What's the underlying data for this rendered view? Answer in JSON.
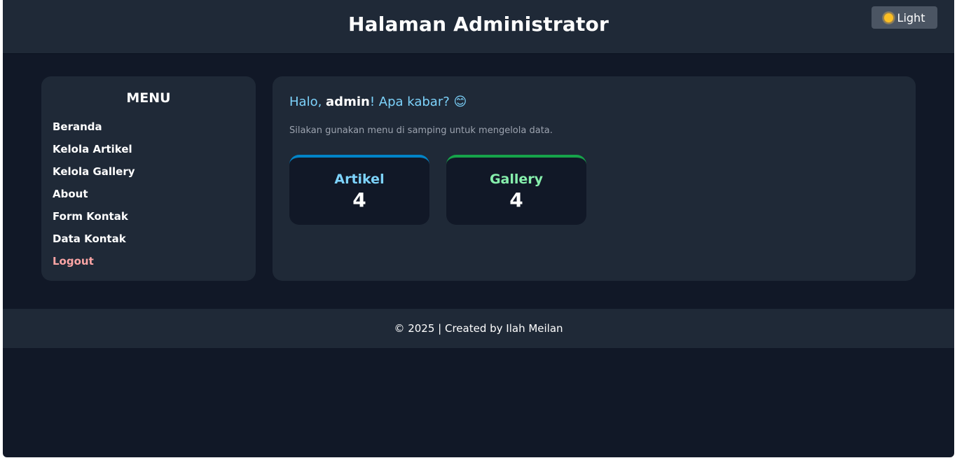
{
  "header": {
    "title": "Halaman Administrator",
    "theme_toggle": {
      "label": "Light",
      "icon": "sun-icon"
    }
  },
  "sidebar": {
    "title": "MENU",
    "items": [
      {
        "label": "Beranda"
      },
      {
        "label": "Kelola Artikel"
      },
      {
        "label": "Kelola Gallery"
      },
      {
        "label": "About"
      },
      {
        "label": "Form Kontak"
      },
      {
        "label": "Data Kontak"
      },
      {
        "label": "Logout",
        "color": "#fca5a5"
      }
    ]
  },
  "main": {
    "greeting_prefix": "Halo, ",
    "username": "admin",
    "greeting_suffix": "! Apa kabar? 😊",
    "subtext": "Silakan gunakan menu di samping untuk mengelola data.",
    "stats": [
      {
        "label": "Artikel",
        "value": "4",
        "accent": "#0284c7"
      },
      {
        "label": "Gallery",
        "value": "4",
        "accent": "#16a34a"
      }
    ]
  },
  "footer": {
    "text": "© 2025 | Created by Ilah Meilan"
  },
  "colors": {
    "background": "#111827",
    "panel": "#1f2937",
    "greeting": "#7dd3fc"
  }
}
